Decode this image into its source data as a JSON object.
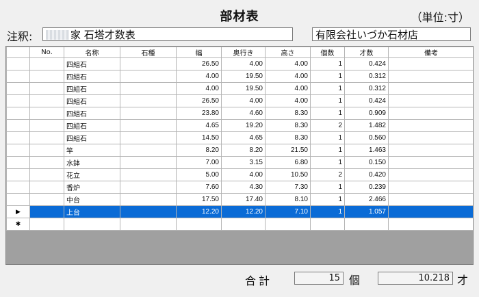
{
  "header": {
    "title": "部材表",
    "unit": "（単位:寸）",
    "note_label": "注釈:",
    "note_value": "家 石塔才数表",
    "shop_name": "有限会社いづか石材店"
  },
  "table": {
    "columns": [
      "No.",
      "名称",
      "石種",
      "幅",
      "奥行き",
      "高さ",
      "個数",
      "才数",
      "備考"
    ],
    "rows": [
      {
        "no": "",
        "name": "四組石",
        "stone": "",
        "width": "26.50",
        "depth": "4.00",
        "height": "4.00",
        "count": "1",
        "sai": "0.424",
        "note": ""
      },
      {
        "no": "",
        "name": "四組石",
        "stone": "",
        "width": "4.00",
        "depth": "19.50",
        "height": "4.00",
        "count": "1",
        "sai": "0.312",
        "note": ""
      },
      {
        "no": "",
        "name": "四組石",
        "stone": "",
        "width": "4.00",
        "depth": "19.50",
        "height": "4.00",
        "count": "1",
        "sai": "0.312",
        "note": ""
      },
      {
        "no": "",
        "name": "四組石",
        "stone": "",
        "width": "26.50",
        "depth": "4.00",
        "height": "4.00",
        "count": "1",
        "sai": "0.424",
        "note": ""
      },
      {
        "no": "",
        "name": "四組石",
        "stone": "",
        "width": "23.80",
        "depth": "4.60",
        "height": "8.30",
        "count": "1",
        "sai": "0.909",
        "note": ""
      },
      {
        "no": "",
        "name": "四組石",
        "stone": "",
        "width": "4.65",
        "depth": "19.20",
        "height": "8.30",
        "count": "2",
        "sai": "1.482",
        "note": ""
      },
      {
        "no": "",
        "name": "四組石",
        "stone": "",
        "width": "14.50",
        "depth": "4.65",
        "height": "8.30",
        "count": "1",
        "sai": "0.560",
        "note": ""
      },
      {
        "no": "",
        "name": "竿",
        "stone": "",
        "width": "8.20",
        "depth": "8.20",
        "height": "21.50",
        "count": "1",
        "sai": "1.463",
        "note": ""
      },
      {
        "no": "",
        "name": "水鉢",
        "stone": "",
        "width": "7.00",
        "depth": "3.15",
        "height": "6.80",
        "count": "1",
        "sai": "0.150",
        "note": ""
      },
      {
        "no": "",
        "name": "花立",
        "stone": "",
        "width": "5.00",
        "depth": "4.00",
        "height": "10.50",
        "count": "2",
        "sai": "0.420",
        "note": ""
      },
      {
        "no": "",
        "name": "香炉",
        "stone": "",
        "width": "7.60",
        "depth": "4.30",
        "height": "7.30",
        "count": "1",
        "sai": "0.239",
        "note": ""
      },
      {
        "no": "",
        "name": "中台",
        "stone": "",
        "width": "17.50",
        "depth": "17.40",
        "height": "8.10",
        "count": "1",
        "sai": "2.466",
        "note": ""
      },
      {
        "no": "",
        "name": "上台",
        "stone": "",
        "width": "12.20",
        "depth": "12.20",
        "height": "7.10",
        "count": "1",
        "sai": "1.057",
        "note": ""
      }
    ],
    "selected_marker": "▶",
    "new_row_marker": "✱"
  },
  "footer": {
    "total_label": "合計",
    "total_count": "15",
    "count_unit": "個",
    "total_sai": "10.218",
    "sai_unit": "才"
  },
  "colors": {
    "selection": "#0a6bd6",
    "grid_background": "#a0a0a0"
  }
}
